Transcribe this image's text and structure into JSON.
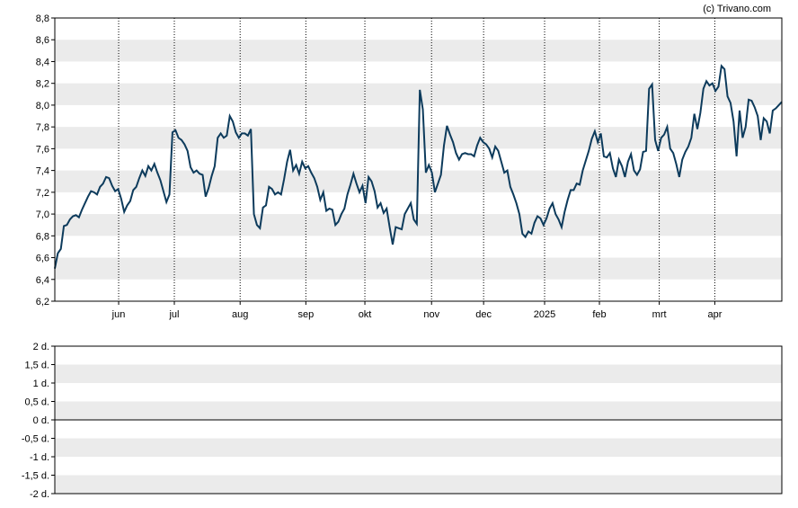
{
  "copyright": "(c) Trivano.com",
  "colors": {
    "line": "#0d3b5c",
    "band": "#ebebeb",
    "frame": "#000000",
    "vgrid": "#000000"
  },
  "chart_data": [
    {
      "type": "line",
      "title": "",
      "xlabel": "",
      "ylabel": "",
      "ylim": [
        6.2,
        8.8
      ],
      "yticks": [
        "8,8",
        "8,6",
        "8,4",
        "8,2",
        "8,0",
        "7,8",
        "7,6",
        "7,4",
        "7,2",
        "7,0",
        "6,8",
        "6,6",
        "6,4",
        "6,2"
      ],
      "xticks": [
        "jun",
        "jul",
        "aug",
        "sep",
        "okt",
        "nov",
        "dec",
        "2025",
        "feb",
        "mrt",
        "apr"
      ],
      "grid": "alternating horizontal bands, dotted vertical lines at month ticks",
      "series": [
        {
          "values": [
            6.5,
            6.64,
            6.68,
            6.89,
            6.9,
            6.95,
            6.98,
            6.99,
            6.97,
            7.04,
            7.1,
            7.16,
            7.21,
            7.2,
            7.18,
            7.25,
            7.28,
            7.34,
            7.33,
            7.26,
            7.21,
            7.23,
            7.14,
            7.02,
            7.08,
            7.12,
            7.22,
            7.25,
            7.33,
            7.4,
            7.35,
            7.44,
            7.4,
            7.46,
            7.38,
            7.31,
            7.21,
            7.11,
            7.18,
            7.75,
            7.77,
            7.7,
            7.68,
            7.64,
            7.58,
            7.43,
            7.38,
            7.4,
            7.37,
            7.36,
            7.16,
            7.24,
            7.35,
            7.44,
            7.7,
            7.74,
            7.7,
            7.72,
            7.9,
            7.85,
            7.75,
            7.7,
            7.74,
            7.74,
            7.72,
            7.78,
            7.0,
            6.9,
            6.87,
            7.06,
            7.08,
            7.25,
            7.23,
            7.18,
            7.2,
            7.18,
            7.32,
            7.48,
            7.59,
            7.4,
            7.45,
            7.37,
            7.48,
            7.42,
            7.44,
            7.38,
            7.33,
            7.25,
            7.13,
            7.2,
            7.03,
            7.05,
            7.04,
            6.9,
            6.93,
            7.0,
            7.05,
            7.18,
            7.27,
            7.37,
            7.28,
            7.2,
            7.26,
            7.1,
            7.34,
            7.3,
            7.21,
            7.06,
            7.1,
            7.01,
            7.05,
            6.88,
            6.72,
            6.88,
            6.87,
            6.86,
            7.0,
            7.05,
            7.1,
            6.95,
            6.91,
            8.14,
            7.96,
            7.38,
            7.45,
            7.38,
            7.2,
            7.28,
            7.36,
            7.63,
            7.81,
            7.73,
            7.66,
            7.56,
            7.5,
            7.55,
            7.56,
            7.55,
            7.55,
            7.53,
            7.63,
            7.7,
            7.66,
            7.64,
            7.6,
            7.52,
            7.62,
            7.58,
            7.48,
            7.38,
            7.4,
            7.25,
            7.18,
            7.1,
            7.0,
            6.82,
            6.79,
            6.84,
            6.82,
            6.92,
            6.98,
            6.96,
            6.9,
            6.96,
            7.05,
            7.1,
            7.0,
            6.95,
            6.88,
            7.02,
            7.13,
            7.22,
            7.22,
            7.28,
            7.27,
            7.4,
            7.49,
            7.58,
            7.69,
            7.76,
            7.66,
            7.74,
            7.53,
            7.52,
            7.56,
            7.42,
            7.34,
            7.5,
            7.44,
            7.34,
            7.48,
            7.55,
            7.4,
            7.36,
            7.41,
            7.57,
            7.58,
            8.15,
            8.19,
            7.68,
            7.58,
            7.7,
            7.73,
            7.8,
            7.6,
            7.56,
            7.46,
            7.34,
            7.5,
            7.57,
            7.62,
            7.7,
            7.92,
            7.78,
            7.93,
            8.15,
            8.22,
            8.18,
            8.2,
            8.13,
            8.17,
            8.36,
            8.33,
            8.08,
            8.02,
            7.85,
            7.53,
            7.95,
            7.7,
            7.8,
            8.05,
            8.04,
            7.98,
            7.9,
            7.68,
            7.88,
            7.85,
            7.74,
            7.95,
            7.97,
            8.0,
            8.03
          ]
        }
      ]
    },
    {
      "type": "line",
      "title": "",
      "ylim": [
        -2,
        2
      ],
      "yticks": [
        "2 d.",
        "1,5 d.",
        "1 d.",
        "0,5 d.",
        "0 d.",
        "-0,5 d.",
        "-1 d.",
        "-1,5 d.",
        "-2 d."
      ],
      "grid": "alternating horizontal bands",
      "series": [
        {
          "values": [
            0,
            0
          ]
        }
      ]
    }
  ]
}
